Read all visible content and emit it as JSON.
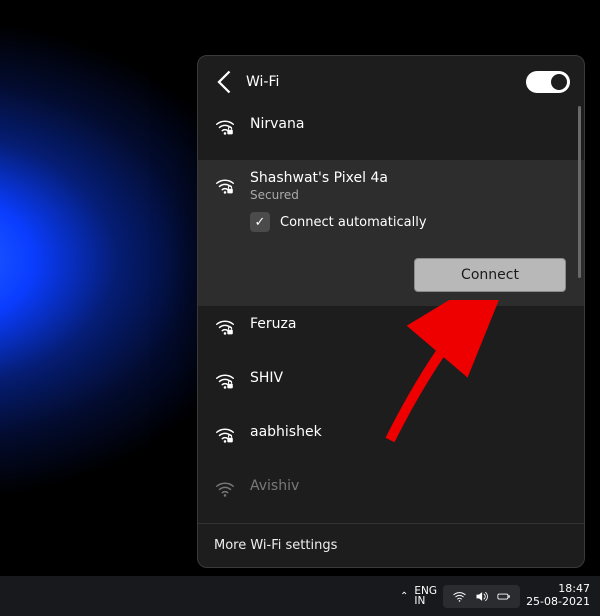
{
  "panel": {
    "title": "Wi-Fi",
    "settings": "More Wi-Fi settings"
  },
  "networks": {
    "n0": "Nirvana",
    "selected": {
      "name": "Shashwat's Pixel 4a",
      "status": "Secured",
      "auto": "Connect automatically",
      "connect": "Connect"
    },
    "n2": "Feruza",
    "n3": "SHIV",
    "n4": "aabhishek",
    "n5": "Avishiv"
  },
  "taskbar": {
    "lang1": "ENG",
    "lang2": "IN",
    "time": "18:47",
    "date": "25-08-2021"
  }
}
